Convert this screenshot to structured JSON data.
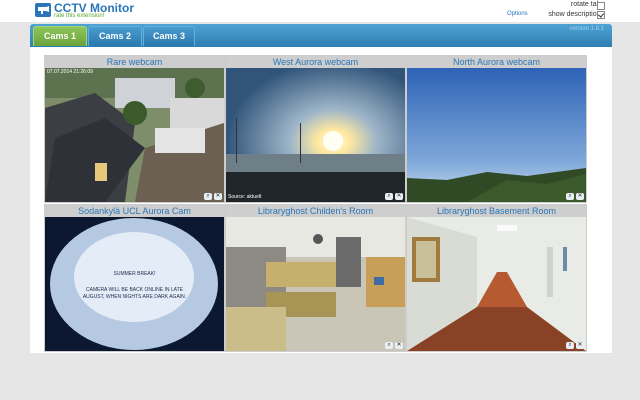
{
  "app": {
    "title": "CCTV Monitor",
    "rate_link": "rate this extension!",
    "options_link": "Options",
    "rotate_tabs_label": "rotate tabs",
    "show_descriptions_label": "show descriptions",
    "rotate_tabs_checked": false,
    "show_descriptions_checked": true
  },
  "tabs": [
    {
      "label": "Cams 1",
      "active": true
    },
    {
      "label": "Cams 2",
      "active": false
    },
    {
      "label": "Cams 3",
      "active": false
    }
  ],
  "version": "version 1.8.1",
  "cams": [
    {
      "title": "Rare webcam",
      "stamp": "07.07.2014 21:26:09"
    },
    {
      "title": "West Aurora webcam",
      "stamp": "Source: aktuelt"
    },
    {
      "title": "North Aurora webcam",
      "stamp": ""
    },
    {
      "title": "Sodankylä UCL Aurora Cam",
      "stamp": "",
      "overlay_line1": "SUMMER BREAK!",
      "overlay_line2": "CAMERA WILL BE BACK ONLINE IN LATE",
      "overlay_line3": "AUGUST, WHEN NIGHTS ARE DARK AGAIN."
    },
    {
      "title": "Libraryghost Childen's Room",
      "stamp": ""
    },
    {
      "title": "Libraryghost Basement Room",
      "stamp": ""
    }
  ],
  "colors": {
    "accent": "#2a76b8",
    "tab_active": "#7ab247",
    "tab_bar": "#3a8cc2"
  }
}
